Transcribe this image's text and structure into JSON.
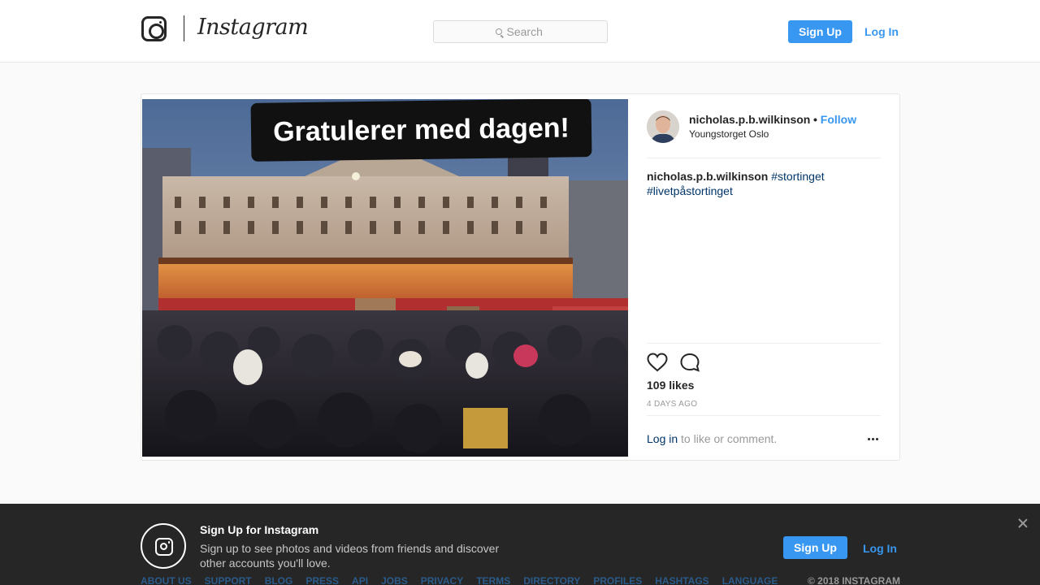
{
  "header": {
    "wordmark": "Instagram",
    "search_placeholder": "Search",
    "signup_label": "Sign Up",
    "login_label": "Log In"
  },
  "post": {
    "image_banner_text": "Gratulerer med dagen!",
    "username": "nicholas.p.b.wilkinson",
    "dot": "•",
    "follow_label": "Follow",
    "location": "Youngstorget Oslo",
    "caption_user": "nicholas.p.b.wilkinson",
    "hashtags": [
      "#stortinget",
      "#livetpåstortinget"
    ],
    "likes": "109 likes",
    "time_ago": "4 DAYS AGO",
    "login_link": "Log in",
    "login_suffix": " to like or comment."
  },
  "footer": {
    "title": "Sign Up for Instagram",
    "description": "Sign up to see photos and videos from friends and discover other accounts you'll love.",
    "signup_label": "Sign Up",
    "login_label": "Log In",
    "nav": [
      "ABOUT US",
      "SUPPORT",
      "BLOG",
      "PRESS",
      "API",
      "JOBS",
      "PRIVACY",
      "TERMS",
      "DIRECTORY",
      "PROFILES",
      "HASHTAGS",
      "LANGUAGE"
    ],
    "copyright": "© 2018 INSTAGRAM"
  },
  "colors": {
    "accent": "#3897f0",
    "hashtag": "#003569",
    "footer_bg": "#262626"
  }
}
